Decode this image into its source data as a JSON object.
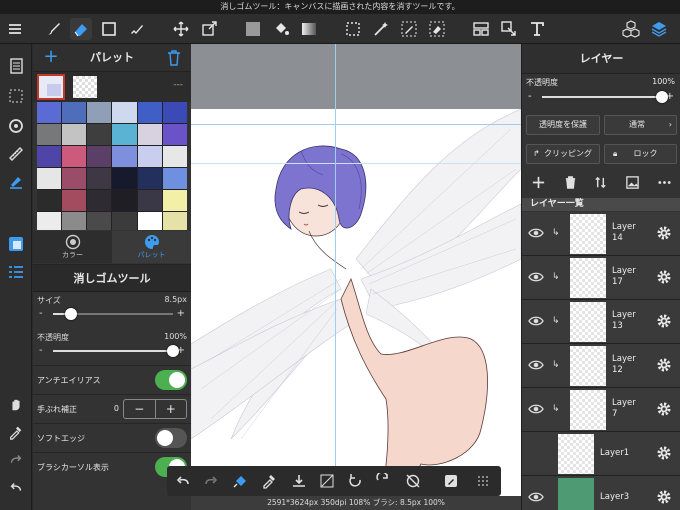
{
  "status": {
    "message": "消しゴムツール：キャンバスに描画された内容を消すツールです。"
  },
  "toolbar": {
    "left": [
      "menu-icon",
      "brush-icon",
      "eraser-icon",
      "rectangle-icon",
      "marker-icon",
      "move-icon",
      "transform-icon",
      "fill-color-icon",
      "bucket-icon",
      "gradient-icon",
      "select-rect-icon",
      "magic-wand-icon",
      "select-pen-icon",
      "select-eraser-icon",
      "frame-icon",
      "operation-icon",
      "text-icon",
      "material-icon",
      "layer-icon"
    ]
  },
  "left_panel": {
    "title": "パレット",
    "swatch_hint": "---",
    "palette_colors": [
      "#5a6bd6",
      "#4f6dbb",
      "#909fb8",
      "#ced8ee",
      "#3f5fc6",
      "#3c4ab8",
      "#77787a",
      "#c3c3c3",
      "#3e3e3e",
      "#5bb3d3",
      "#d8d2e0",
      "#6a52c8",
      "#4f44a8",
      "#cb5a7c",
      "#5b3f66",
      "#7e90dd",
      "#c9cdee",
      "#e7e7e7",
      "#e6e6e6",
      "#9a4c68",
      "#3d3844",
      "#161a2c",
      "#23305e",
      "#6f8fe0",
      "#2b2b2b",
      "#a34b5f",
      "#2f2b33",
      "#1f1e24",
      "#3a3846",
      "#f4efa7",
      "#ececec",
      "#8b8b8b",
      "#4a4a4a",
      "#3b3b3b",
      "#ffffff",
      "#e6e1a6"
    ],
    "modes": [
      {
        "label": "カラー"
      },
      {
        "label": "パレット"
      }
    ],
    "tool_title": "消しゴムツール",
    "size": {
      "label": "サイズ",
      "value": "8.5px",
      "level": 0.15
    },
    "opacity": {
      "label": "不透明度",
      "value": "100%",
      "level": 1.0
    },
    "antialias": {
      "label": "アンチエイリアス",
      "on": true
    },
    "stabilizer": {
      "label": "手ぶれ補正",
      "value": "0"
    },
    "soft_edge": {
      "label": "ソフトエッジ",
      "on": false
    },
    "brush_cursor": {
      "label": "ブラシカーソル表示",
      "on": true
    }
  },
  "canvas": {
    "info": "2591*3624px 350dpi 108% ブラシ: 8.5px 100%"
  },
  "right_panel": {
    "title": "レイヤー",
    "opacity_label": "不透明度",
    "opacity_value": "100%",
    "protect_button": "透明度を保護",
    "blend_mode": "通常",
    "clipping_button": "クリッピング",
    "lock_button": "ロック",
    "layer_list_title": "レイヤー一覧",
    "layers": [
      {
        "name": "Layer\n14",
        "clipped": true
      },
      {
        "name": "Layer\n17",
        "clipped": true
      },
      {
        "name": "Layer\n13",
        "clipped": true
      },
      {
        "name": "Layer\n12",
        "clipped": true
      },
      {
        "name": "Layer\n7",
        "clipped": true
      },
      {
        "name": "Layer1",
        "clipped": false
      },
      {
        "name": "Layer3",
        "clipped": false
      }
    ]
  }
}
